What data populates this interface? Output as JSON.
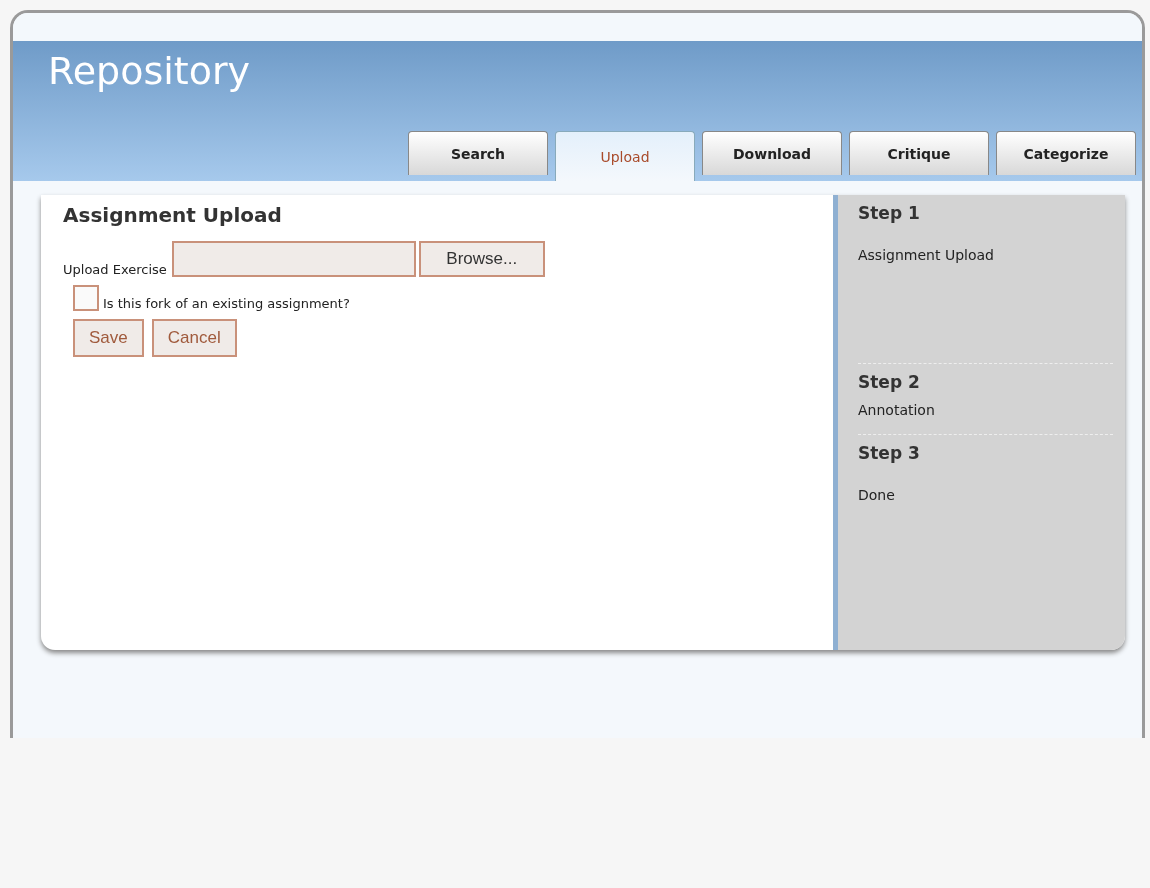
{
  "header": {
    "title": "Repository"
  },
  "tabs": [
    {
      "label": "Search",
      "selected": false
    },
    {
      "label": "Upload",
      "selected": true
    },
    {
      "label": "Download",
      "selected": false
    },
    {
      "label": "Critique",
      "selected": false
    },
    {
      "label": "Categorize",
      "selected": false
    }
  ],
  "form": {
    "heading": "Assignment Upload",
    "upload_label": "Upload Exercise",
    "browse_button": "Browse...",
    "fork_checkbox": {
      "label": "Is this fork of an existing assignment?",
      "checked": false
    },
    "buttons": [
      "Save",
      "Cancel"
    ]
  },
  "steps": [
    {
      "title": "Step 1",
      "label": "Assignment Upload"
    },
    {
      "title": "Step 2",
      "label": "Annotation"
    },
    {
      "title": "Step 3",
      "label": "Done"
    }
  ]
}
